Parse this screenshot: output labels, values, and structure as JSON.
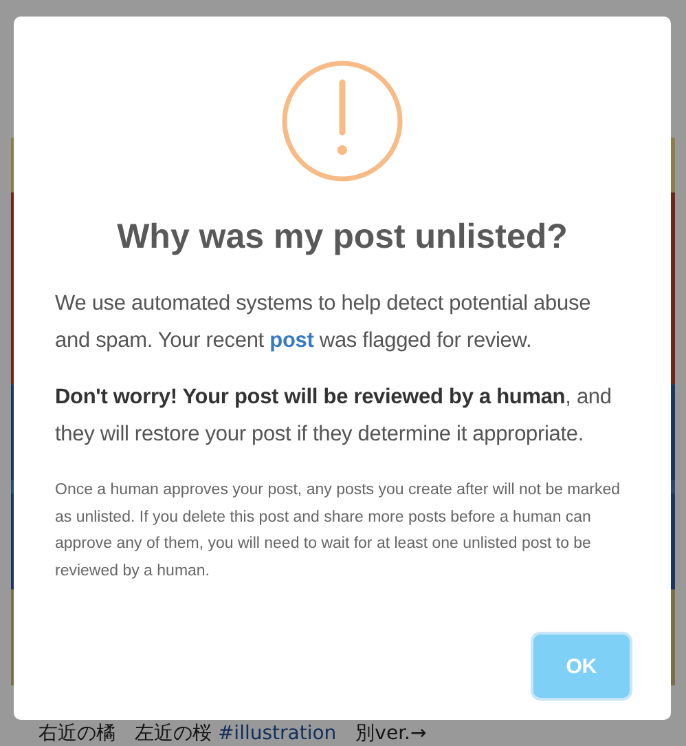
{
  "background_post": {
    "caption": {
      "text": "右近の橘　左近の桜",
      "hashtag": "#illustration",
      "after": "別ver.→"
    }
  },
  "dialog": {
    "title": "Why was my post unlisted?",
    "paragraph_1": {
      "before": "We use automated systems to help detect potential abuse and spam. Your recent",
      "link": "post",
      "after": "was flagged for review."
    },
    "paragraph_2": "**Don't worry! Your post will be reviewed by a human**, and they will restore your post if they determine it appropriate.",
    "note": "Once a human approves your post, any posts you create after will not be marked as unlisted. If you delete this post and share more posts before a human can approve any of them, you will need to wait for at least one unlisted post to be reviewed by a human.",
    "button": "OK"
  }
}
